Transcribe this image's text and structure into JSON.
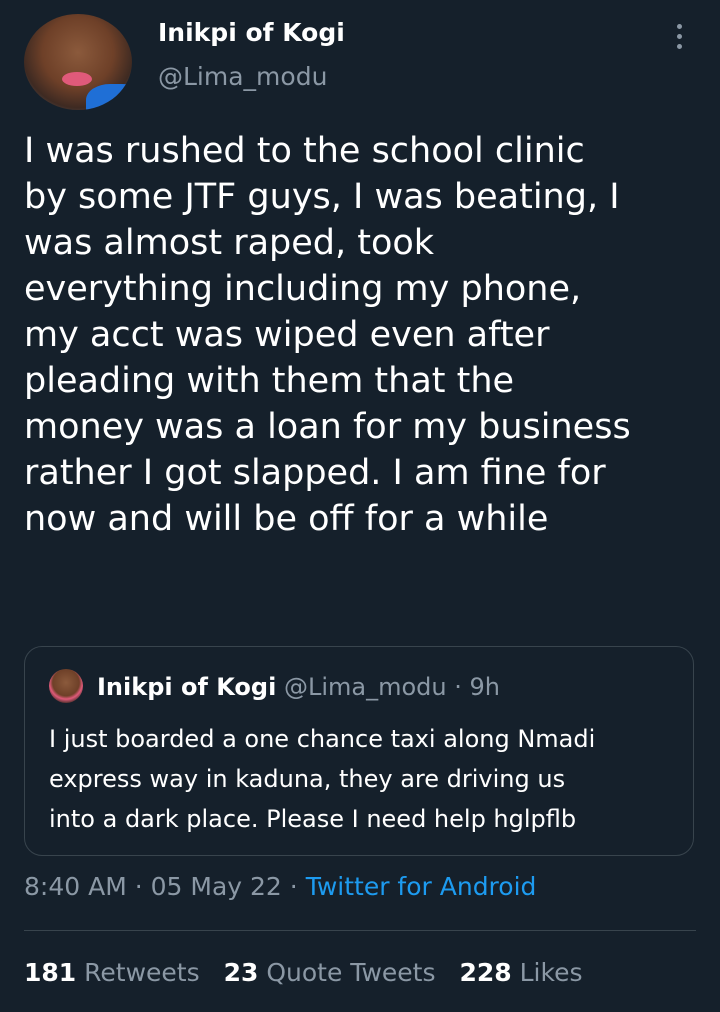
{
  "author": {
    "name": "Inikpi of Kogi",
    "handle": "@Lima_modu"
  },
  "tweet": {
    "lines": [
      "I was rushed to the school clinic",
      "by some JTF guys, I was beating, I",
      "was almost raped, took",
      "everything including my phone,",
      "my acct was wiped even after",
      "pleading with them that the",
      "money was a loan for my business",
      "rather I got slapped. I am fine for",
      "now and will be off for a while"
    ]
  },
  "quoted_tweet": {
    "name": "Inikpi of Kogi",
    "handle": "@Lima_modu",
    "time": "9h",
    "lines": [
      "I just boarded a one chance taxi along Nmadi",
      "express way in kaduna, they are driving us",
      "into a dark place. Please I need help hglpflb"
    ]
  },
  "meta": {
    "time": "8:40 AM",
    "date": "05 May 22",
    "source": "Twitter for Android",
    "separator": "·"
  },
  "stats": {
    "retweets_count": "181",
    "retweets_label": "Retweets",
    "quotes_count": "23",
    "quotes_label": "Quote Tweets",
    "likes_count": "228",
    "likes_label": "Likes"
  },
  "colors": {
    "background": "#15202b",
    "secondary_text": "#8b98a5",
    "link": "#1d9bf0",
    "border": "#38444d"
  },
  "icons": {
    "more": "more-vertical-icon"
  }
}
